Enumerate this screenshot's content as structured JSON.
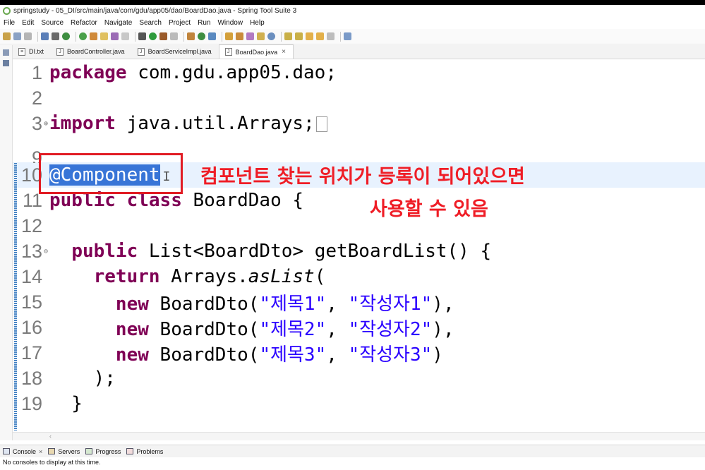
{
  "window": {
    "title": "springstudy - 05_DI/src/main/java/com/gdu/app05/dao/BoardDao.java - Spring Tool Suite 3"
  },
  "menu": [
    "File",
    "Edit",
    "Source",
    "Refactor",
    "Navigate",
    "Search",
    "Project",
    "Run",
    "Window",
    "Help"
  ],
  "editor_tabs": [
    {
      "label": "DI.txt",
      "icon": "text-file-icon"
    },
    {
      "label": "BoardController.java",
      "icon": "java-file-icon"
    },
    {
      "label": "BoardServiceImpl.java",
      "icon": "java-file-icon"
    },
    {
      "label": "BoardDao.java",
      "icon": "java-file-icon",
      "active": true
    }
  ],
  "code": {
    "line_numbers": [
      "1",
      "2",
      "3",
      "9",
      "10",
      "11",
      "12",
      "13",
      "14",
      "15",
      "16",
      "17",
      "18",
      "19"
    ],
    "l1_kw": "package",
    "l1_rest": " com.gdu.app05.dao;",
    "l3_kw": "import",
    "l3_rest": " java.util.Arrays;",
    "l10_annotation": "@Component",
    "l11_kw1": "public",
    "l11_kw2": "class",
    "l11_rest": " BoardDao {",
    "l13_kw": "public",
    "l13_rest": " List<BoardDto> getBoardList() {",
    "l14_kw": "return",
    "l14_mid": " Arrays.",
    "l14_method": "asList",
    "l14_end": "(",
    "new_kw": "new",
    "ctor": " BoardDto(",
    "rows": [
      {
        "title": "\"제목1\"",
        "writer": "\"작성자1\"",
        "end": "),"
      },
      {
        "title": "\"제목2\"",
        "writer": "\"작성자2\"",
        "end": "),"
      },
      {
        "title": "\"제목3\"",
        "writer": "\"작성자3\"",
        "end": ")"
      }
    ],
    "comma": ", ",
    "l18": "    );",
    "l19": "  }"
  },
  "annotation": {
    "line1": "컴포넌트 찾는 위치가 등록이 되어있으면",
    "line2": "사용할 수 있음",
    "color": "#ef1d26"
  },
  "bottom_tabs": [
    {
      "label": "Console",
      "icon": "console-icon",
      "closable": true
    },
    {
      "label": "Servers",
      "icon": "servers-icon"
    },
    {
      "label": "Progress",
      "icon": "progress-icon"
    },
    {
      "label": "Problems",
      "icon": "problems-icon"
    }
  ],
  "console_message": "No consoles to display at this time."
}
